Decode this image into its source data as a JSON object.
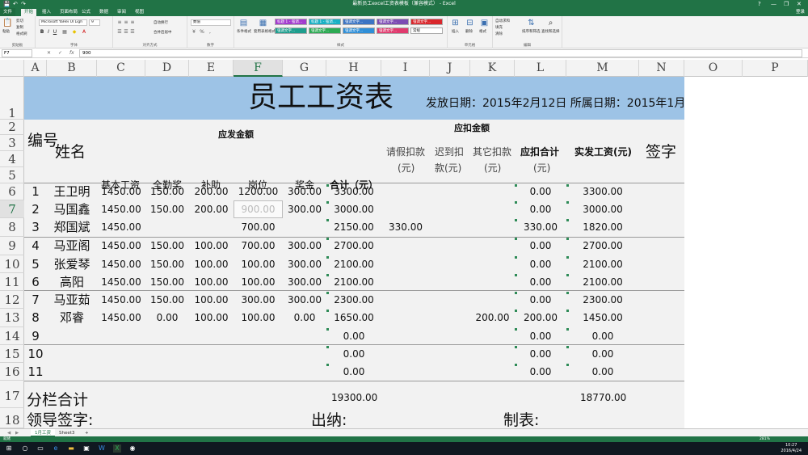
{
  "window": {
    "title": "最新员工excel工资表模板（兼容模式） - Excel",
    "quick_access": [
      "💾",
      "↶",
      "↷"
    ],
    "controls": [
      "?",
      "—",
      "❐",
      "✕"
    ]
  },
  "tabs": [
    "文件",
    "开始",
    "插入",
    "页面布局",
    "公式",
    "数据",
    "审阅",
    "视图"
  ],
  "user": "登录",
  "ribbon": {
    "clipboard": {
      "paste": "粘贴",
      "cut": "剪切",
      "copy": "复制",
      "format": "格式刷",
      "label": "剪贴板"
    },
    "font": {
      "name": "Microsoft YaHei UI Ligh",
      "size": "9",
      "label": "字体"
    },
    "align": {
      "wrap": "自动换行",
      "merge": "合并后居中",
      "label": "对齐方式"
    },
    "number": {
      "format": "数值",
      "label": "数字"
    },
    "styles": {
      "conditional": "条件格式",
      "table": "套用表格格式",
      "cells": [
        "标题 1 - 强调...",
        "标题 1 - 强调...",
        "强调文字...",
        "强调文字...",
        "强调文字...",
        "强调文字...",
        "强调文字...",
        "强调文字...",
        "强调文字...",
        "常规"
      ],
      "label": "样式"
    },
    "cells_group": {
      "insert": "插入",
      "delete": "删除",
      "format": "格式",
      "label": "单元格"
    },
    "editing": {
      "autosum": "自动求和",
      "fill": "填充",
      "clear": "清除",
      "sort": "排序和筛选",
      "find": "查找和选择",
      "label": "编辑"
    }
  },
  "formula_bar": {
    "name_box": "F7",
    "cancel": "✕",
    "enter": "✓",
    "fx": "fx",
    "value": "900"
  },
  "columns": [
    "A",
    "B",
    "C",
    "D",
    "E",
    "F",
    "G",
    "H",
    "I",
    "J",
    "K",
    "L",
    "M",
    "N",
    "O",
    "P"
  ],
  "selected_column": "F",
  "rows": [
    "1",
    "2",
    "3",
    "4",
    "5",
    "6",
    "7",
    "8",
    "9",
    "10",
    "11",
    "12",
    "13",
    "14",
    "15",
    "16",
    "17",
    "18"
  ],
  "selected_row": "7",
  "sheet": {
    "title": "员工工资表",
    "issue_date": "发放日期：2015年2月12日 所属日期：2015年1月",
    "group_payable": "应发金额",
    "group_deduct": "应扣金额",
    "headers": {
      "no": "编号",
      "name": "姓名",
      "base": "基本工资",
      "attendance": "全勤奖",
      "subsidy": "补助",
      "post": "岗位",
      "bonus": "奖金",
      "total": "合计（元）",
      "leave1": "请假扣款",
      "leave2": "(元)",
      "late1": "迟到扣",
      "late2": "款(元)",
      "other1": "其它扣款",
      "other2": "(元)",
      "deduct1": "应扣合计",
      "deduct2": "(元)",
      "net": "实发工资(元)",
      "sign": "签字"
    },
    "records": [
      {
        "no": "1",
        "name": "王卫明",
        "base": "1450.00",
        "att": "150.00",
        "sub": "200.00",
        "post": "1200.00",
        "bonus": "300.00",
        "total": "3300.00",
        "leave": "",
        "late": "",
        "other": "",
        "ded": "0.00",
        "net": "3300.00"
      },
      {
        "no": "2",
        "name": "马国鑫",
        "base": "1450.00",
        "att": "150.00",
        "sub": "200.00",
        "post": "900.00",
        "bonus": "300.00",
        "total": "3000.00",
        "leave": "",
        "late": "",
        "other": "",
        "ded": "0.00",
        "net": "3000.00"
      },
      {
        "no": "3",
        "name": "郑国斌",
        "base": "1450.00",
        "att": "",
        "sub": "",
        "post": "700.00",
        "bonus": "",
        "total": "2150.00",
        "leave": "330.00",
        "late": "",
        "other": "",
        "ded": "330.00",
        "net": "1820.00"
      },
      {
        "no": "4",
        "name": "马亚阁",
        "base": "1450.00",
        "att": "150.00",
        "sub": "100.00",
        "post": "700.00",
        "bonus": "300.00",
        "total": "2700.00",
        "leave": "",
        "late": "",
        "other": "",
        "ded": "0.00",
        "net": "2700.00"
      },
      {
        "no": "5",
        "name": "张爱琴",
        "base": "1450.00",
        "att": "150.00",
        "sub": "100.00",
        "post": "100.00",
        "bonus": "300.00",
        "total": "2100.00",
        "leave": "",
        "late": "",
        "other": "",
        "ded": "0.00",
        "net": "2100.00"
      },
      {
        "no": "6",
        "name": "高阳",
        "base": "1450.00",
        "att": "150.00",
        "sub": "100.00",
        "post": "100.00",
        "bonus": "300.00",
        "total": "2100.00",
        "leave": "",
        "late": "",
        "other": "",
        "ded": "0.00",
        "net": "2100.00"
      },
      {
        "no": "7",
        "name": "马亚茹",
        "base": "1450.00",
        "att": "150.00",
        "sub": "100.00",
        "post": "300.00",
        "bonus": "300.00",
        "total": "2300.00",
        "leave": "",
        "late": "",
        "other": "",
        "ded": "0.00",
        "net": "2300.00"
      },
      {
        "no": "8",
        "name": "邓睿",
        "base": "1450.00",
        "att": "0.00",
        "sub": "100.00",
        "post": "100.00",
        "bonus": "0.00",
        "total": "1650.00",
        "leave": "",
        "late": "",
        "other": "200.00",
        "ded": "200.00",
        "net": "1450.00"
      },
      {
        "no": "9",
        "name": "",
        "base": "",
        "att": "",
        "sub": "",
        "post": "",
        "bonus": "",
        "total": "0.00",
        "leave": "",
        "late": "",
        "other": "",
        "ded": "0.00",
        "net": "0.00"
      },
      {
        "no": "10",
        "name": "",
        "base": "",
        "att": "",
        "sub": "",
        "post": "",
        "bonus": "",
        "total": "0.00",
        "leave": "",
        "late": "",
        "other": "",
        "ded": "0.00",
        "net": "0.00"
      },
      {
        "no": "11",
        "name": "",
        "base": "",
        "att": "",
        "sub": "",
        "post": "",
        "bonus": "",
        "total": "0.00",
        "leave": "",
        "late": "",
        "other": "",
        "ded": "0.00",
        "net": "0.00"
      }
    ],
    "subtotal_label": "分栏合计",
    "subtotal_total": "19300.00",
    "subtotal_net": "18770.00",
    "leader_sign": "领导签字:",
    "cashier": "出纳:",
    "preparer": "制表:"
  },
  "sheet_tabs": [
    "1月工资",
    "Sheet3",
    "+"
  ],
  "status": {
    "left": "就绪",
    "zoom": "281%"
  },
  "taskbar": {
    "time": "10:27",
    "date": "2016/4/24"
  },
  "colors": {
    "excel_green": "#217346",
    "title_band": "#9dc3e6",
    "body_band": "#f2f2f2"
  }
}
